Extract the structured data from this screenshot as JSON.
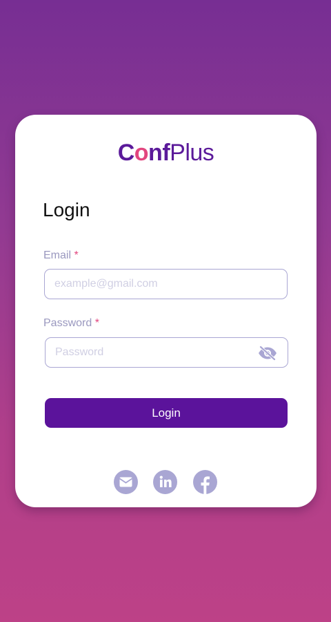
{
  "logo": {
    "part_c": "C",
    "part_o": "o",
    "part_nf": "nf",
    "part_plus": "Plus"
  },
  "form": {
    "title": "Login",
    "email": {
      "label": "Email",
      "required_mark": "*",
      "placeholder": "example@gmail.com",
      "value": ""
    },
    "password": {
      "label": "Password",
      "required_mark": "*",
      "placeholder": "Password",
      "value": "",
      "toggle_icon": "eye-slash-icon"
    },
    "submit_label": "Login"
  },
  "socials": [
    {
      "icon": "envelope-icon"
    },
    {
      "icon": "linkedin-icon"
    },
    {
      "icon": "facebook-icon"
    }
  ],
  "colors": {
    "brand_purple": "#5b139b",
    "accent_pink": "#e2467f",
    "muted_lavender": "#a9a6d3",
    "gradient_top": "#772e93",
    "gradient_bottom": "#bd4187"
  }
}
